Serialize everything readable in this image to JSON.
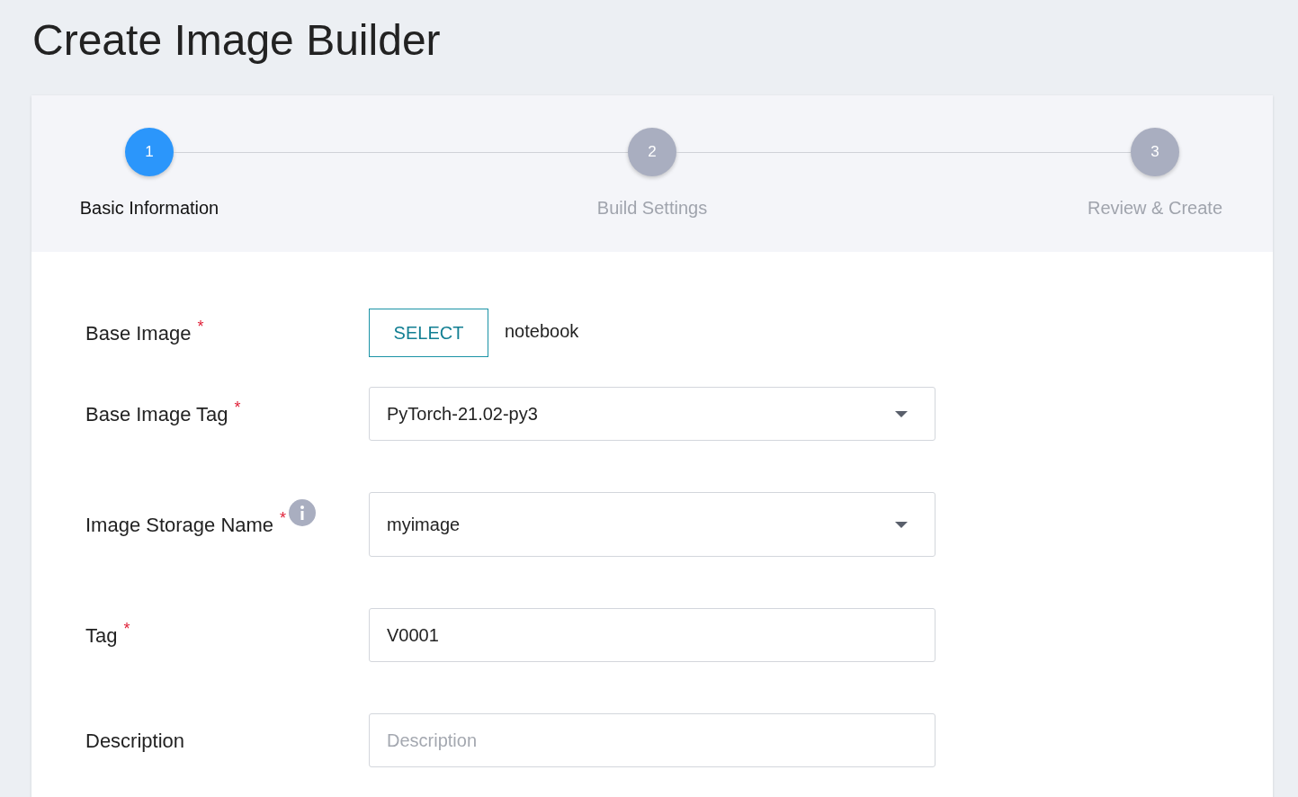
{
  "page": {
    "title": "Create Image Builder"
  },
  "steps": [
    {
      "number": "1",
      "label": "Basic Information",
      "selected": true
    },
    {
      "number": "2",
      "label": "Build Settings",
      "selected": false
    },
    {
      "number": "3",
      "label": "Review & Create",
      "selected": false
    }
  ],
  "fields": [
    {
      "kind": "select_button",
      "label": "Base Image",
      "required_mark": "*",
      "info": false,
      "button": "SELECT",
      "value": "notebook"
    },
    {
      "kind": "dropdown",
      "label": "Base Image Tag",
      "required_mark": "*",
      "info": false,
      "value": "PyTorch-21.02-py3"
    },
    {
      "kind": "dropdown_tall",
      "label": "Image Storage Name",
      "required_mark": "*",
      "info": true,
      "value": "myimage"
    },
    {
      "kind": "text",
      "label": "Tag",
      "required_mark": "*",
      "info": false,
      "value": "V0001"
    },
    {
      "kind": "text",
      "label": "Description",
      "info": false,
      "placeholder": "Description"
    }
  ]
}
